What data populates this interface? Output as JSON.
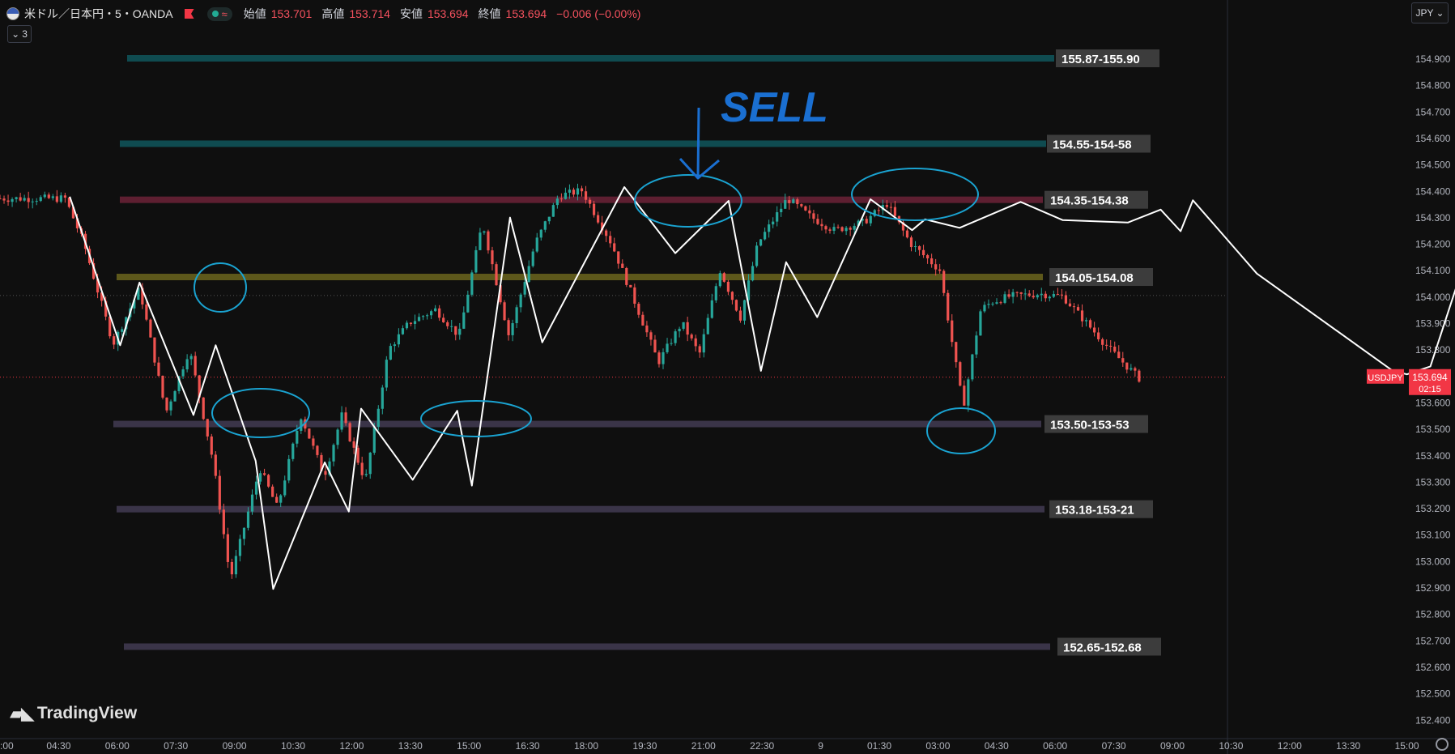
{
  "header": {
    "symbol": "米ドル／日本円・5・OANDA",
    "wave_glyph": "≈",
    "open_label": "始値",
    "open": "153.701",
    "high_label": "高値",
    "high": "153.714",
    "low_label": "安値",
    "low": "153.694",
    "close_label": "終値",
    "close": "153.694",
    "change": "−0.006 (−0.00%)"
  },
  "indicators_button": {
    "chevron": "⌄",
    "count": "3"
  },
  "currency_button": {
    "label": "JPY",
    "chevron": "⌄"
  },
  "logo": {
    "text": "TradingView",
    "mark": "17"
  },
  "colors": {
    "bg": "#0f0f0f",
    "up": "#26a69a",
    "down": "#ef5350",
    "accent_red": "#f23645",
    "teal_zone": "#0f4b50",
    "red_zone": "#5e1f31",
    "olive_zone": "#5d581b",
    "purple_zone": "#3a3448",
    "annotation_cyan": "#1aa3d1",
    "annotation_blue": "#1a6fd1",
    "trend_white": "#ffffff"
  },
  "chart_data": {
    "type": "candlestick",
    "symbol": "USDJPY",
    "ylim": [
      152.334,
      155.058
    ],
    "y_ticks": [
      154.9,
      154.8,
      154.7,
      154.6,
      154.5,
      154.4,
      154.3,
      154.2,
      154.1,
      154.0,
      153.9,
      153.8,
      153.7,
      153.6,
      153.5,
      153.4,
      153.3,
      153.2,
      153.1,
      153.0,
      152.9,
      152.8,
      152.7,
      152.6,
      152.5,
      152.4
    ],
    "x_ticks": [
      ":00",
      "04:30",
      "06:00",
      "07:30",
      "09:00",
      "10:30",
      "12:00",
      "13:30",
      "15:00",
      "16:30",
      "18:00",
      "19:30",
      "21:00",
      "22:30",
      "9",
      "01:30",
      "03:00",
      "04:30",
      "06:00",
      "07:30",
      "09:00",
      "10:30",
      "12:00",
      "13:30",
      "15:00"
    ],
    "last_price": {
      "symbol": "USDJPY",
      "price": "153.694",
      "countdown": "02:15"
    },
    "crosshair_price": 154.003,
    "zones": [
      {
        "label": "155.87-155.90",
        "price": 154.9,
        "color": "#0f4b50"
      },
      {
        "label": "154.55-154-58",
        "price": 154.577,
        "color": "#0f4b50"
      },
      {
        "label": "154.35-154.38",
        "price": 154.365,
        "color": "#5e1f31"
      },
      {
        "label": "154.05-154.08",
        "price": 154.073,
        "color": "#5d581b"
      },
      {
        "label": "153.50-153-53",
        "price": 153.517,
        "color": "#3a3448"
      },
      {
        "label": "153.18-153-21",
        "price": 153.195,
        "color": "#3a3448"
      },
      {
        "label": "152.65-152.68",
        "price": 152.675,
        "color": "#3a3448"
      }
    ],
    "annotation_text": "SELL",
    "trend_path_x_ticks": [
      1.19,
      2.05,
      2.38,
      3.3,
      3.68,
      4.36,
      4.66,
      5.54,
      5.95,
      6.16,
      7.04,
      7.8,
      8.05,
      8.7,
      9.25,
      10.65,
      11.52,
      12.43,
      12.98,
      13.41,
      13.94,
      14.85,
      15.56,
      15.78,
      16.37,
      17.41,
      18.13,
      19.24,
      19.8,
      20.14,
      20.35,
      21.44,
      23.76,
      24.0,
      24.4,
      24.86,
      25.2,
      25.55,
      26.16,
      26.52
    ],
    "trend_path_prices": [
      154.377,
      153.815,
      154.052,
      153.551,
      153.815,
      153.378,
      152.893,
      153.372,
      153.186,
      153.575,
      153.306,
      153.567,
      153.284,
      154.298,
      153.826,
      154.413,
      154.163,
      154.361,
      153.718,
      154.129,
      153.921,
      154.367,
      154.25,
      154.291,
      154.259,
      154.357,
      154.288,
      154.279,
      154.328,
      154.246,
      154.363,
      154.086,
      153.718,
      153.705,
      153.735,
      154.047,
      154.001,
      154.064,
      153.885,
      153.935
    ],
    "candles_note": "synthetic approximation of the visible price series",
    "candle_path_x_ticks": [
      0,
      1.18,
      1.5,
      2.0,
      2.45,
      2.9,
      3.3,
      3.7,
      4.0,
      4.5,
      4.8,
      5.2,
      5.6,
      5.9,
      6.3,
      6.7,
      7.05,
      7.5,
      7.9,
      8.3,
      8.75,
      9.2,
      9.6,
      10.0,
      10.5,
      10.95,
      11.3,
      11.7,
      12.0,
      12.35,
      12.7,
      13.0,
      13.5,
      13.9,
      14.3,
      14.8,
      15.2,
      15.6,
      16.1,
      16.5,
      16.8,
      17.0,
      17.3,
      17.8,
      18.2,
      18.6,
      19.0,
      19.5
    ],
    "candle_path_prices": [
      154.37,
      154.37,
      154.2,
      153.82,
      154.03,
      153.56,
      153.8,
      153.38,
      152.93,
      153.35,
      153.2,
      153.55,
      153.32,
      153.55,
      153.3,
      153.8,
      153.9,
      153.95,
      153.85,
      154.28,
      153.85,
      154.2,
      154.38,
      154.4,
      154.2,
      153.95,
      153.75,
      153.9,
      153.78,
      154.1,
      153.92,
      154.2,
      154.37,
      154.3,
      154.25,
      154.28,
      154.35,
      154.2,
      154.1,
      153.58,
      153.95,
      153.98,
      154.0,
      154.01,
      154.0,
      153.9,
      153.8,
      153.69
    ]
  }
}
